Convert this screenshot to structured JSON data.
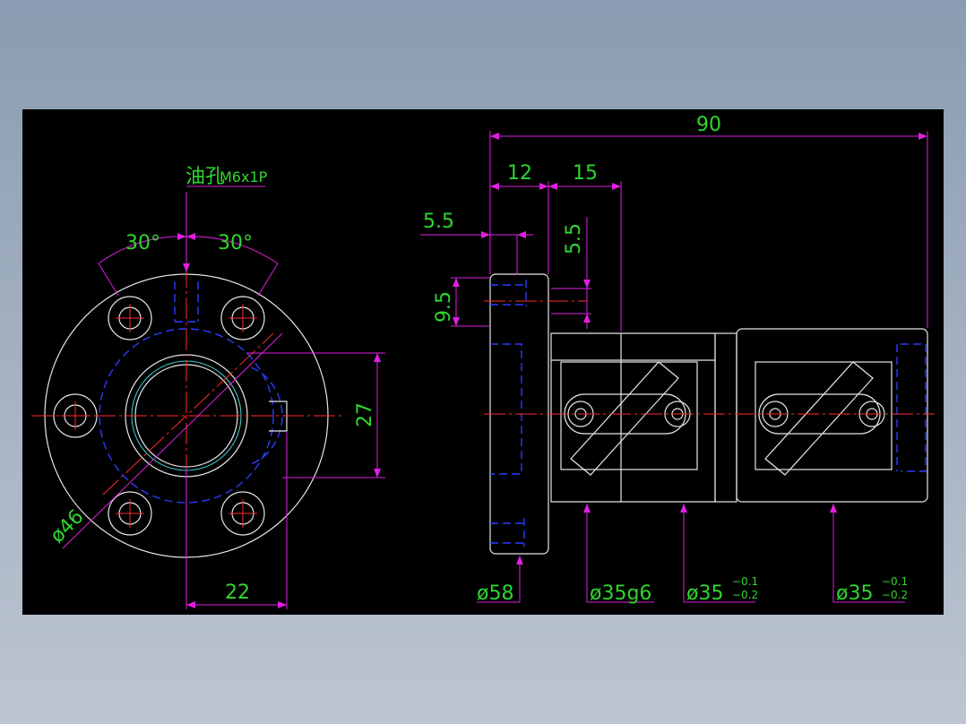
{
  "labels": {
    "oil_hole": "油孔",
    "thread": "M6x1P",
    "angle_left": "30°",
    "angle_right": "30°",
    "height_27": "27",
    "diameter_46": "ø46",
    "width_22": "22",
    "length_90": "90",
    "length_12": "12",
    "length_15": "15",
    "offset_5_5_h": "5.5",
    "offset_5_5_v": "5.5",
    "offset_9_5": "9.5",
    "diameter_58": "ø58",
    "diameter_35g6": "ø35g6",
    "diameter_35_a": "ø35",
    "tol_upper_a": "−0.1",
    "tol_lower_a": "−0.2",
    "diameter_35_b": "ø35",
    "tol_upper_b": "−0.1",
    "tol_lower_b": "−0.2"
  },
  "colors": {
    "background": "#000000",
    "outline": "#e6e6e6",
    "dimension": "#e020e0",
    "centerline": "#ff2a2a",
    "hidden": "#2a3cff",
    "text": "#2fd62f"
  }
}
